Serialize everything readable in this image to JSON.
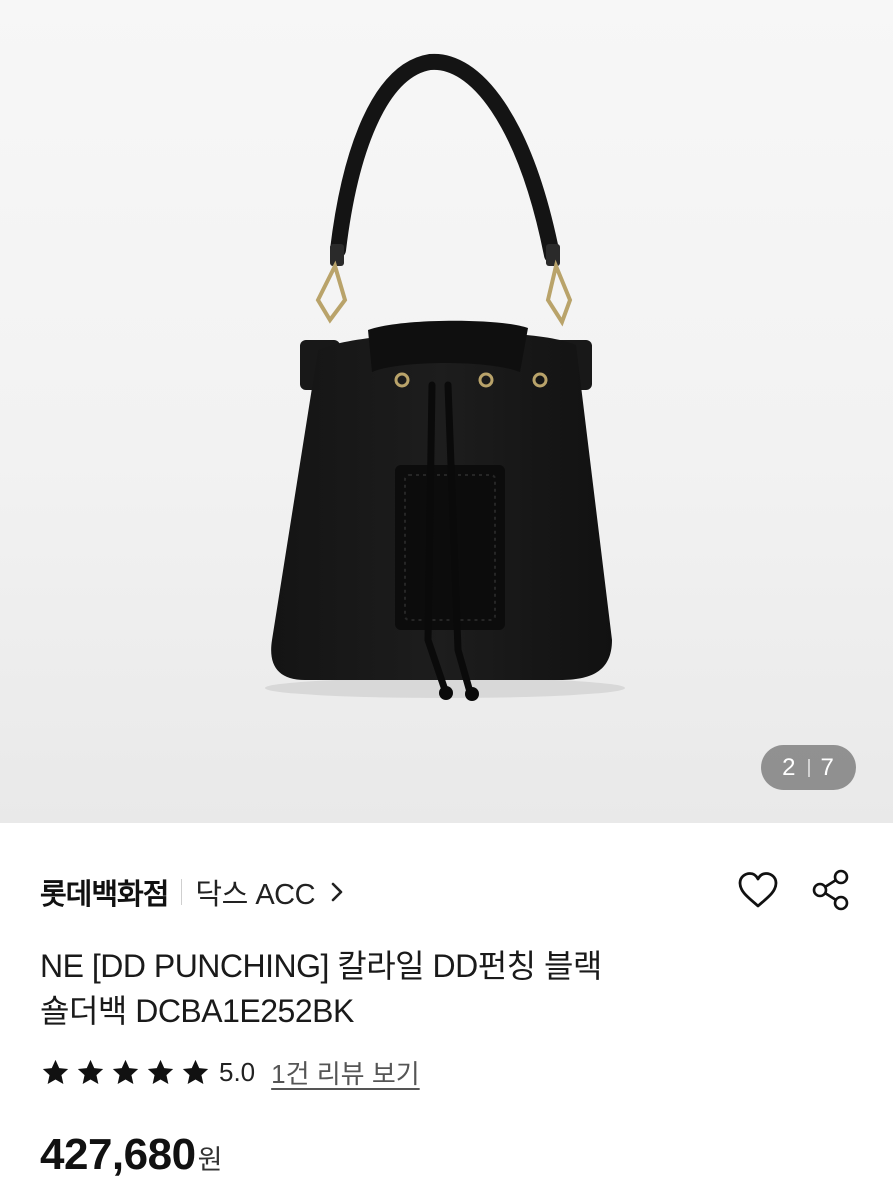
{
  "gallery": {
    "current": "2",
    "total": "7",
    "image_alt": "product-bag-photo"
  },
  "header": {
    "brand": "롯데백화점",
    "category": "닥스 ACC"
  },
  "product": {
    "title_line1": "NE [DD PUNCHING] 칼라일 DD펀칭 블랙",
    "title_line2": "숄더백 DCBA1E252BK",
    "rating": "5.0",
    "stars": 5,
    "reviews_link": "1건 리뷰 보기",
    "price": "427,680",
    "currency": "원"
  },
  "icons": {
    "wishlist": "heart-icon",
    "share": "share-icon",
    "category_arrow": "chevron-right-icon",
    "star": "star-icon"
  }
}
